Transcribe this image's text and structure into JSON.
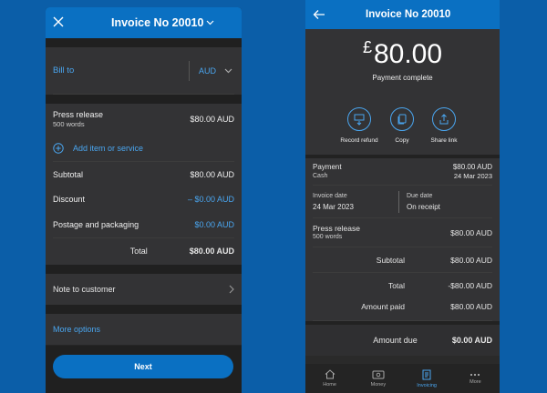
{
  "left": {
    "title": "Invoice No 20010",
    "bill_to_label": "Bill to",
    "currency": "AUD",
    "item": {
      "name": "Press release",
      "sub": "500 words",
      "value": "$80.00 AUD"
    },
    "add_item": "Add item or service",
    "subtotal": {
      "label": "Subtotal",
      "value": "$80.00 AUD"
    },
    "discount": {
      "label": "Discount",
      "value": "– $0.00 AUD"
    },
    "postage": {
      "label": "Postage and packaging",
      "value": "$0.00 AUD"
    },
    "total": {
      "label": "Total",
      "value": "$80.00 AUD"
    },
    "note": "Note to customer",
    "more_options": "More options",
    "next_button": "Next"
  },
  "right": {
    "title": "Invoice No 20010",
    "currency_symbol": "£",
    "amount": "80.00",
    "status": "Payment complete",
    "actions": [
      {
        "label": "Record refund",
        "icon": "record-refund-icon"
      },
      {
        "label": "Copy",
        "icon": "copy-icon"
      },
      {
        "label": "Share link",
        "icon": "share-icon"
      }
    ],
    "payment": {
      "label": "Payment",
      "method": "Cash",
      "value": "$80.00 AUD",
      "date": "24 Mar 2023"
    },
    "invoice_date": {
      "label": "Invoice date",
      "value": "24 Mar 2023"
    },
    "due_date": {
      "label": "Due date",
      "value": "On receipt"
    },
    "item": {
      "name": "Press release",
      "sub": "500 words",
      "value": "$80.00 AUD"
    },
    "subtotal": {
      "label": "Subtotal",
      "value": "$80.00 AUD"
    },
    "total": {
      "label": "Total",
      "value": "-$80.00 AUD"
    },
    "amount_paid": {
      "label": "Amount paid",
      "value": "$80.00 AUD"
    },
    "amount_due": {
      "label": "Amount due",
      "value": "$0.00 AUD"
    },
    "nav": [
      {
        "label": "Home",
        "icon": "home-icon"
      },
      {
        "label": "Money",
        "icon": "money-icon"
      },
      {
        "label": "Invoicing",
        "icon": "invoicing-icon"
      },
      {
        "label": "More",
        "icon": "more-icon"
      }
    ]
  },
  "colors": {
    "brand_blue": "#0a70c2",
    "link_blue": "#4aa6f0",
    "background": "#0b5ea8"
  }
}
